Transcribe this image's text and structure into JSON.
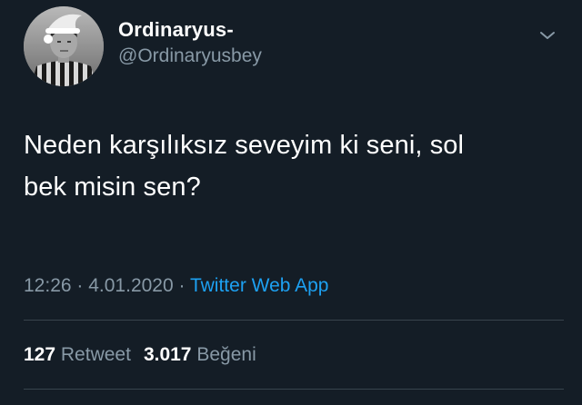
{
  "user": {
    "display_name": "Ordinaryus-",
    "handle": "@Ordinaryusbey",
    "avatar": "profile-photo"
  },
  "tweet": {
    "text_line1": "Neden karşılıksız seveyim ki seni, sol",
    "text_line2": "bek misin sen?"
  },
  "meta": {
    "time": "12:26",
    "separator1": " · ",
    "date": "4.01.2020",
    "separator2": " · ",
    "source": "Twitter Web App"
  },
  "stats": {
    "retweets_count": "127",
    "retweets_label": "Retweet",
    "likes_count": "3.017",
    "likes_label": "Beğeni"
  },
  "colors": {
    "background": "#141d26",
    "primary_text": "#ffffff",
    "secondary_text": "#8899a6",
    "link": "#1da1f2",
    "divider": "#38444d"
  },
  "icons": {
    "menu": "chevron-down-icon"
  }
}
